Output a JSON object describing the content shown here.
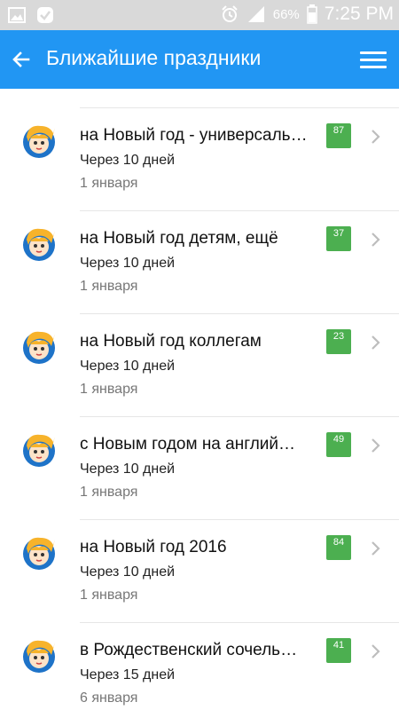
{
  "status_bar": {
    "icons_left": [
      "gallery-icon",
      "check-badge-icon"
    ],
    "icons_right": [
      "alarm-icon",
      "signal-icon"
    ],
    "battery": "66%",
    "time": "7:25 PM"
  },
  "appbar": {
    "title": "Ближайшие праздники",
    "color": "#2196f3"
  },
  "items": [
    {
      "title": "на Новый год - универсаль…",
      "days": "Через 10 дней",
      "date": "1 января",
      "badge": "87"
    },
    {
      "title": "на Новый год детям, ещё",
      "days": "Через 10 дней",
      "date": "1 января",
      "badge": "37"
    },
    {
      "title": "на Новый год коллегам",
      "days": "Через 10 дней",
      "date": "1 января",
      "badge": "23"
    },
    {
      "title": "с Новым годом на англий…",
      "days": "Через 10 дней",
      "date": "1 января",
      "badge": "49"
    },
    {
      "title": "на Новый год 2016",
      "days": "Через 10 дней",
      "date": "1 января",
      "badge": "84"
    },
    {
      "title": "в Рождественский сочель…",
      "days": "Через 15 дней",
      "date": "6 января",
      "badge": "41"
    }
  ],
  "colors": {
    "badge": "#4caf50"
  }
}
